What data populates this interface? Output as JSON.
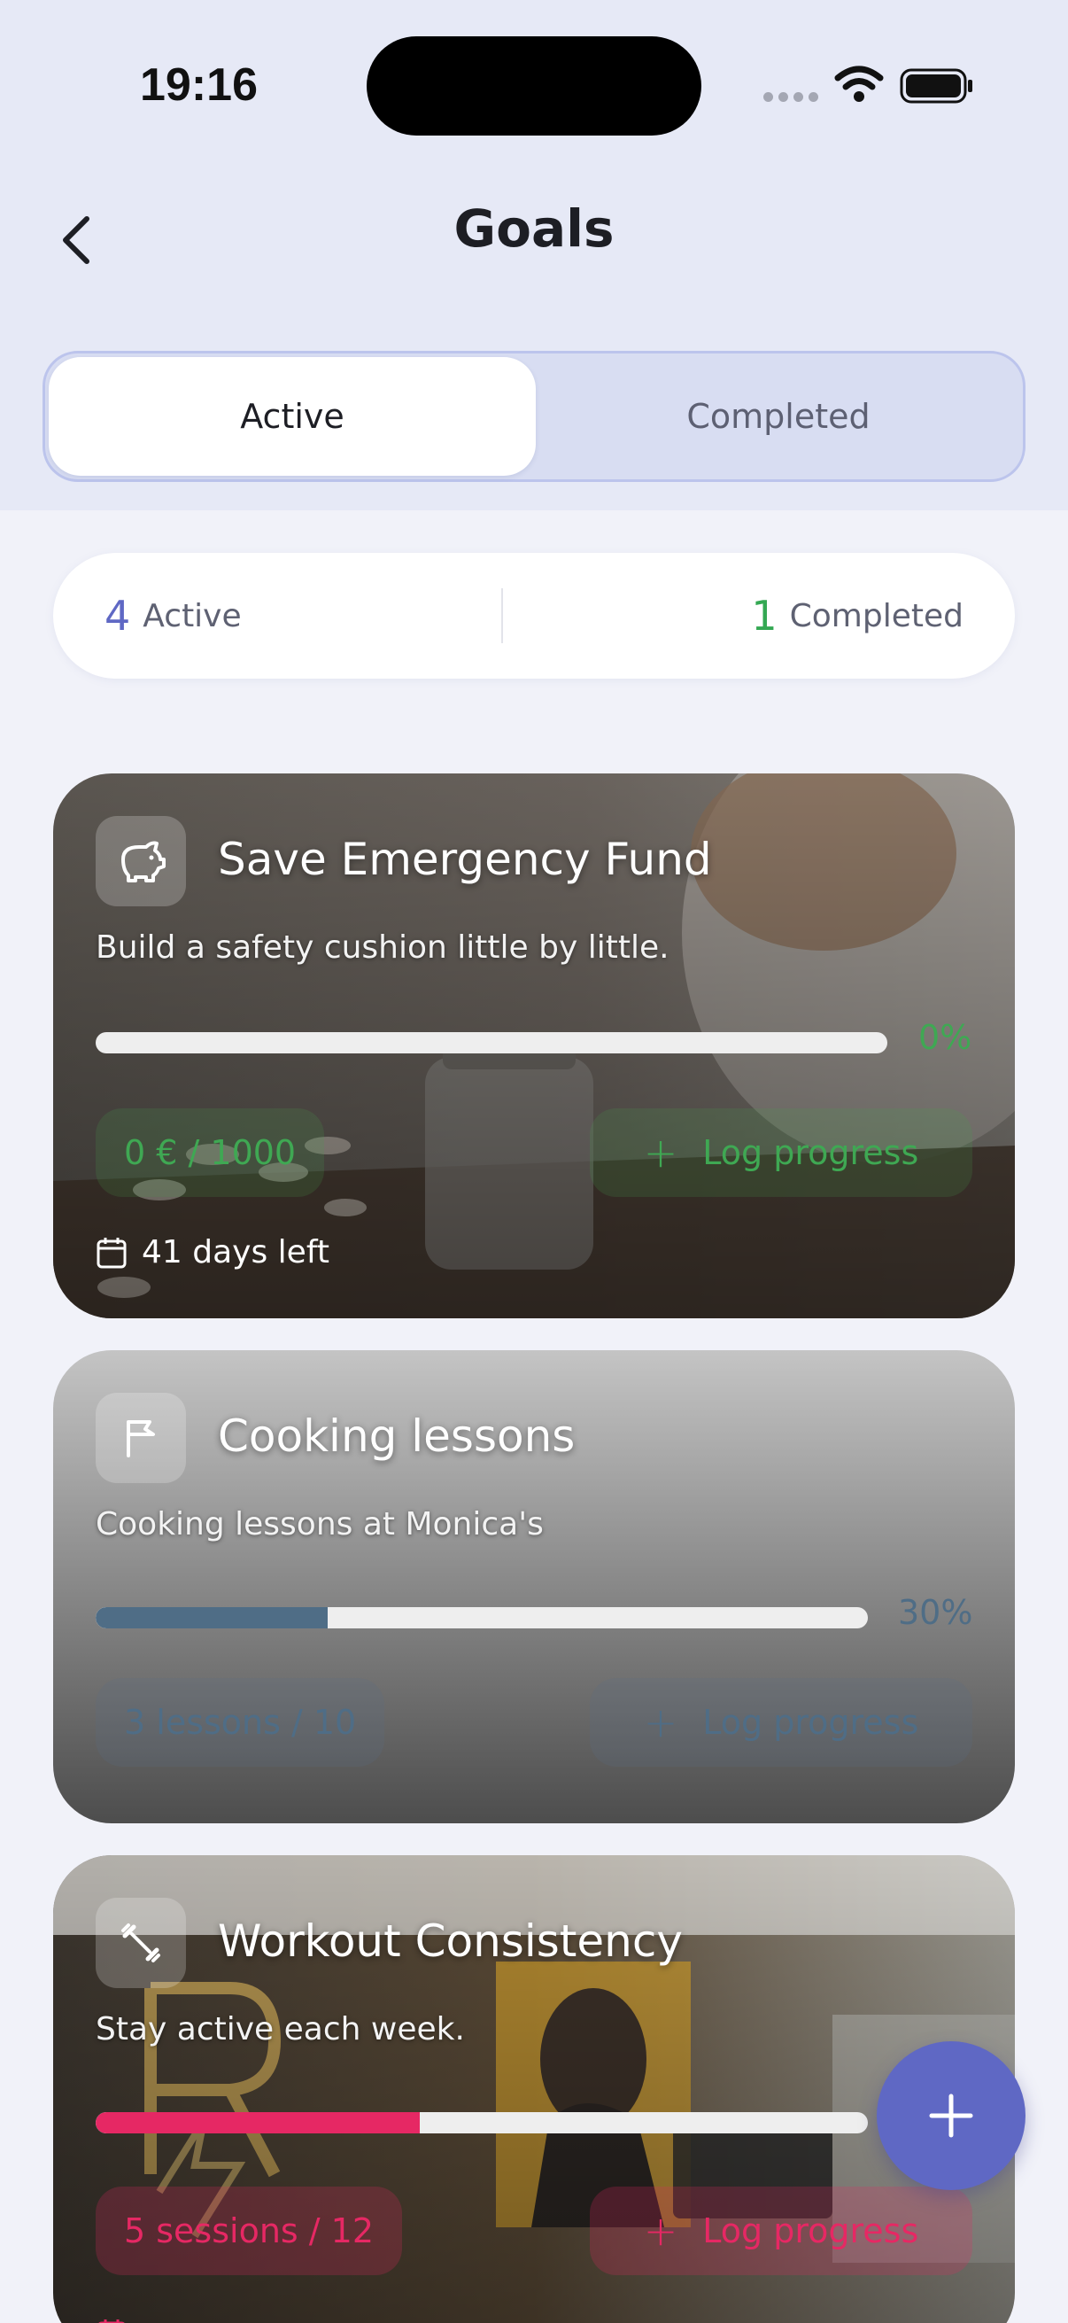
{
  "status_bar": {
    "time": "19:16"
  },
  "header": {
    "title": "Goals"
  },
  "tabs": [
    {
      "label": "Active",
      "selected": true
    },
    {
      "label": "Completed",
      "selected": false
    }
  ],
  "summary": {
    "active_count": "4",
    "active_label": "Active",
    "completed_count": "1",
    "completed_label": "Completed"
  },
  "goals": [
    {
      "icon": "piggy-bank-icon",
      "title": "Save Emergency Fund",
      "description": "Build a safety cushion little by little.",
      "progress_fraction": 0.0,
      "percent_label": "0%",
      "amount": "0 € / 1000",
      "action_label": "Log progress",
      "days_left": "41 days left",
      "accent": "#3fa853"
    },
    {
      "icon": "flag-icon",
      "title": "Cooking lessons",
      "description": "Cooking lessons at Monica's",
      "progress_fraction": 0.3,
      "percent_label": "30%",
      "amount": "3 lessons / 10",
      "action_label": "Log progress",
      "accent": "#4f6d86"
    },
    {
      "icon": "dumbbell-icon",
      "title": "Workout Consistency",
      "description": "Stay active each week.",
      "progress_fraction": 0.42,
      "percent_label": "42%",
      "amount": "5 sessions / 12",
      "action_label": "Log progress",
      "accent": "#e62864"
    }
  ],
  "fab": {
    "icon": "plus-icon"
  }
}
